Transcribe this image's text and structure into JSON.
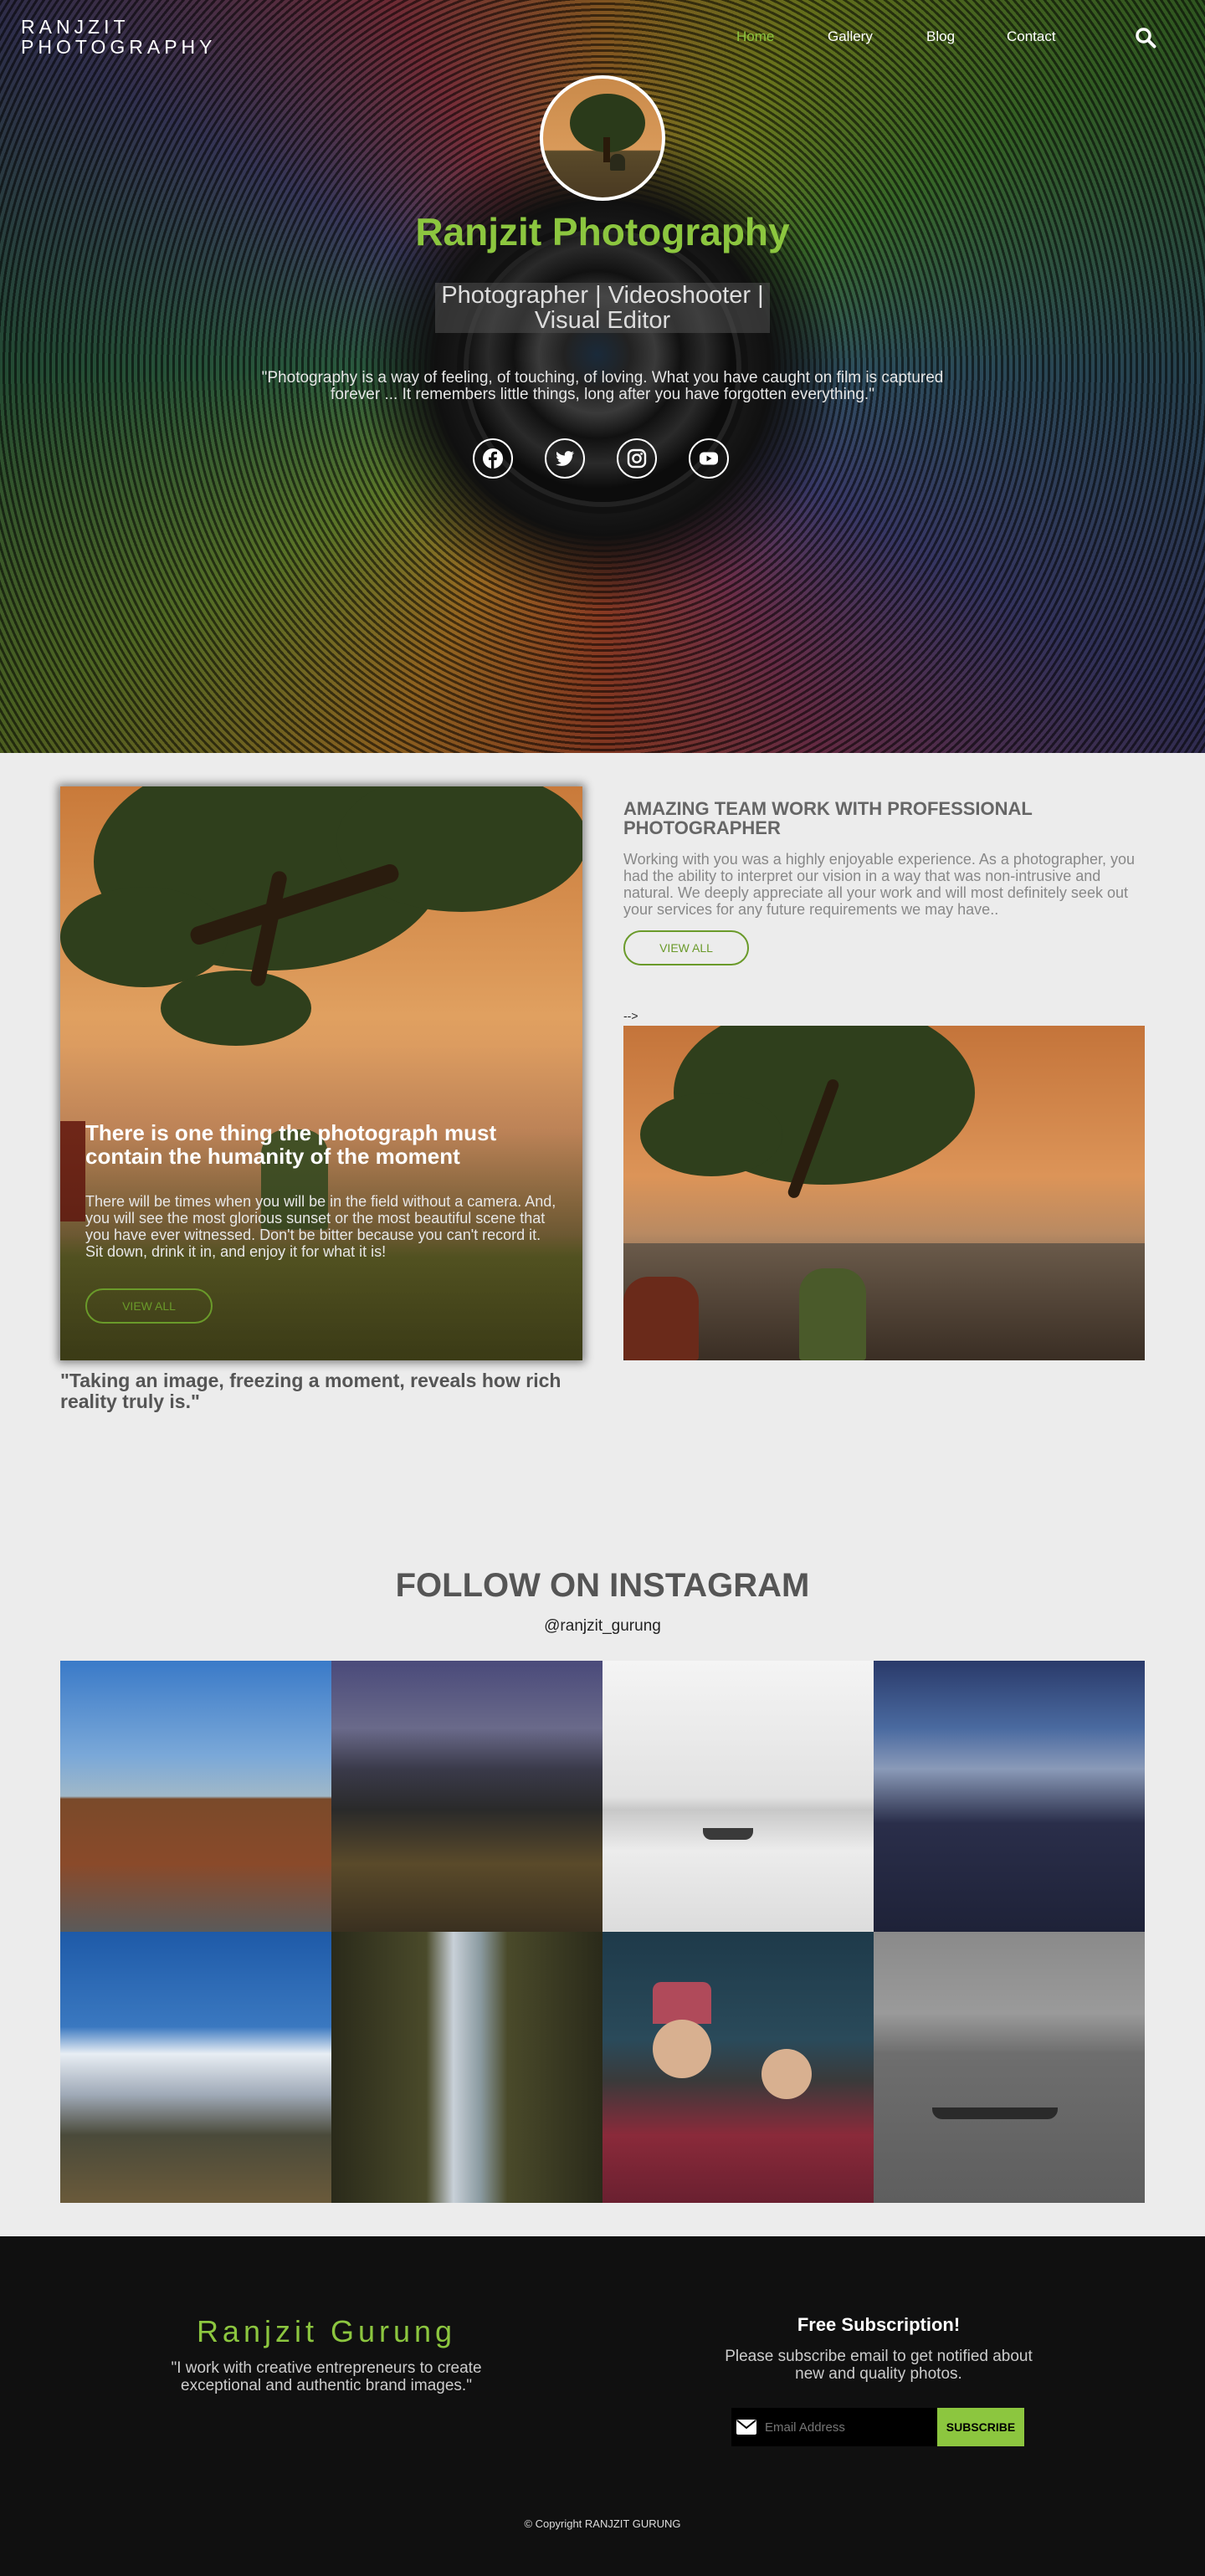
{
  "brand": {
    "line1": "RANJZIT",
    "line2": "PHOTOGRAPHY"
  },
  "nav": {
    "home": "Home",
    "gallery": "Gallery",
    "blog": "Blog",
    "contact": "Contact"
  },
  "hero": {
    "title": "Ranjzit Photography",
    "subtitle_line1": "Photographer | Videoshooter |",
    "subtitle_line2": "Visual Editor",
    "quote": "\"Photography is a way of feeling, of touching, of loving. What you have caught on film is captured forever ... It remembers little things, long after you have forgotten everything.\"",
    "social": [
      "facebook-icon",
      "twitter-icon",
      "instagram-icon",
      "youtube-icon"
    ]
  },
  "feature_card": {
    "title": "There is one thing the photograph must contain the humanity of the moment",
    "text": "There will be times when you will be in the field without a camera. And, you will see the most glorious sunset or the most beautiful scene that you have ever witnessed. Don't be bitter because you can't record it. Sit down, drink it in, and enjoy it for what it is!",
    "button": "VIEW ALL",
    "caption": "\"Taking an image, freezing a moment, reveals how rich reality truly is.\""
  },
  "team": {
    "title": "AMAZING TEAM WORK WITH PROFESSIONAL PHOTOGRAPHER",
    "text": "Working with you was a highly enjoyable experience. As a photographer, you had the ability to interpret our vision in a way that was non-intrusive and natural. We deeply appreciate all your work and will most definitely seek out your services for any future requirements we may have..",
    "button": "VIEW ALL",
    "stray_text": "-->"
  },
  "instagram": {
    "title": "FOLLOW ON INSTAGRAM",
    "handle": "@ranjzit_gurung"
  },
  "footer": {
    "name": "Ranjzit Gurung",
    "quote": "\"I work with creative entrepreneurs to create exceptional and authentic brand images.\"",
    "sub_title": "Free Subscription!",
    "sub_text": "Please subscribe email to get notified about new and quality photos.",
    "email_placeholder": "Email Address",
    "subscribe": "SUBSCRIBE",
    "copyright": "© Copyright RANJZIT GURUNG"
  },
  "colors": {
    "accent": "#8cc63f",
    "footer_bg": "#101010",
    "page_bg": "#ececec"
  }
}
